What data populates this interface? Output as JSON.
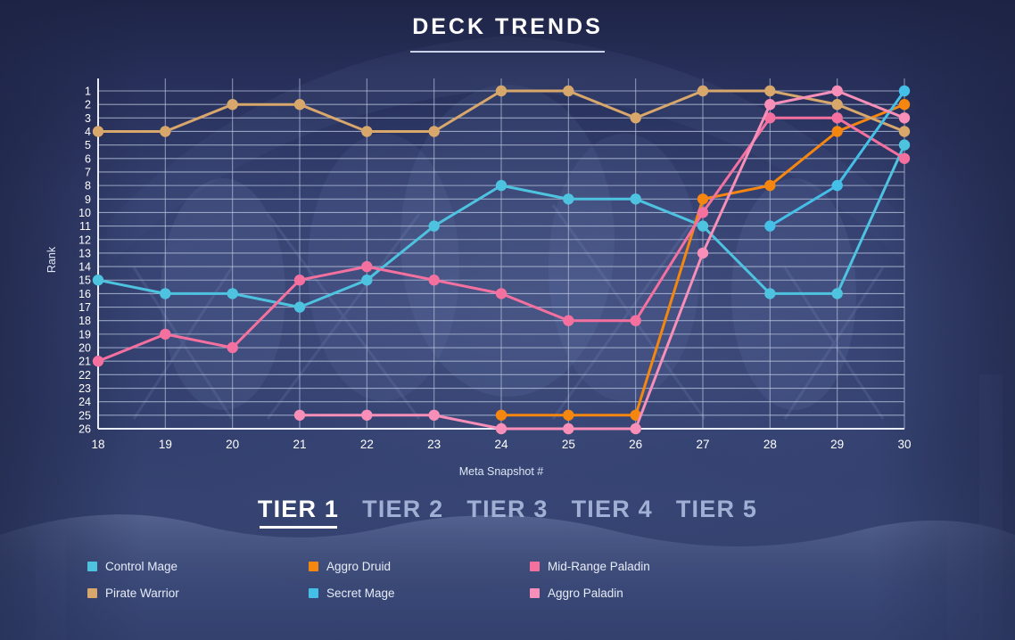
{
  "header": {
    "title": "DECK TRENDS"
  },
  "tiers": [
    {
      "label": "TIER 1",
      "active": true
    },
    {
      "label": "TIER 2",
      "active": false
    },
    {
      "label": "TIER 3",
      "active": false
    },
    {
      "label": "TIER 4",
      "active": false
    },
    {
      "label": "TIER 5",
      "active": false
    }
  ],
  "legend": [
    {
      "label": "Control Mage",
      "color": "#4ec3e0"
    },
    {
      "label": "Aggro Druid",
      "color": "#f5860f"
    },
    {
      "label": "Mid-Range Paladin",
      "color": "#f4719f"
    },
    {
      "label": "Pirate Warrior",
      "color": "#d3a濃"
    },
    {
      "label": "Secret Mage",
      "color": "#4ec3e0"
    },
    {
      "label": "Aggro Paladin",
      "color": "#f78fb8"
    }
  ],
  "chart_data": {
    "type": "line",
    "title": "DECK TRENDS",
    "xlabel": "Meta Snapshot #",
    "ylabel": "Rank",
    "x": [
      18,
      19,
      20,
      21,
      22,
      23,
      24,
      25,
      26,
      27,
      28,
      29,
      30
    ],
    "xlim": [
      18,
      30
    ],
    "ylim": [
      1,
      26
    ],
    "y_inverted": true,
    "yticks": [
      1,
      2,
      3,
      4,
      5,
      6,
      7,
      8,
      9,
      10,
      11,
      12,
      13,
      14,
      15,
      16,
      17,
      18,
      19,
      20,
      21,
      22,
      23,
      24,
      25,
      26
    ],
    "grid": true,
    "legend_position": "bottom",
    "series": [
      {
        "name": "Control Mage",
        "color": "#4ec3e0",
        "values": [
          15,
          16,
          16,
          17,
          15,
          11,
          8,
          9,
          9,
          11,
          16,
          16,
          5
        ]
      },
      {
        "name": "Aggro Druid",
        "color": "#f5860f",
        "values": [
          null,
          null,
          null,
          null,
          null,
          null,
          25,
          25,
          25,
          9,
          8,
          4,
          2
        ]
      },
      {
        "name": "Mid-Range Paladin",
        "color": "#f4719f",
        "values": [
          21,
          19,
          20,
          15,
          14,
          15,
          16,
          18,
          18,
          10,
          3,
          3,
          6
        ]
      },
      {
        "name": "Pirate Warrior",
        "color": "#d8a76b",
        "values": [
          4,
          4,
          2,
          2,
          4,
          4,
          1,
          1,
          3,
          1,
          1,
          2,
          4
        ]
      },
      {
        "name": "Secret Mage",
        "color": "#44bfe8",
        "values": [
          null,
          null,
          null,
          null,
          null,
          null,
          null,
          null,
          null,
          null,
          11,
          8,
          1
        ]
      },
      {
        "name": "Aggro Paladin",
        "color": "#f78fb8",
        "values": [
          null,
          null,
          null,
          25,
          25,
          25,
          26,
          26,
          26,
          13,
          2,
          1,
          3
        ]
      }
    ]
  },
  "colors": {
    "background": "#2b3561",
    "grid": "#b9c4dd",
    "axis_text": "#ffffff",
    "accent": "#ffffff"
  }
}
